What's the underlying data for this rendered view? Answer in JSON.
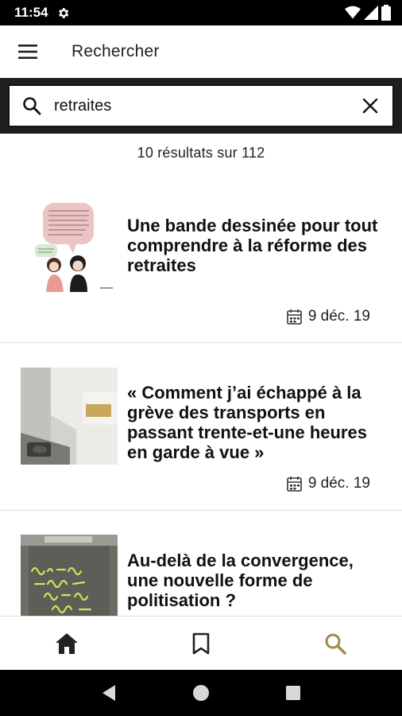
{
  "status_bar": {
    "time": "11:54"
  },
  "app_bar": {
    "title": "Rechercher"
  },
  "search": {
    "value": "retraites",
    "placeholder": ""
  },
  "results": {
    "count_text": "10 résultats sur 112"
  },
  "articles": [
    {
      "title": "Une bande dessinée pour tout comprendre à la réforme des retraites",
      "date": "9 déc. 19"
    },
    {
      "title": "« Comment j’ai échappé à la grève des transports en passant trente-et-une heures en garde à vue »",
      "date": "9 déc. 19"
    },
    {
      "title": "Au-delà de la convergence, une nouvelle forme de politisation ?",
      "date": ""
    }
  ],
  "bottom_nav": {
    "active": "search",
    "active_color": "#a4894f",
    "inactive_color": "#222222"
  },
  "icons": [
    "menu-icon",
    "search-icon",
    "close-icon",
    "calendar-icon",
    "home-icon",
    "bookmark-icon",
    "back-icon",
    "home-circle-icon",
    "recents-icon"
  ]
}
